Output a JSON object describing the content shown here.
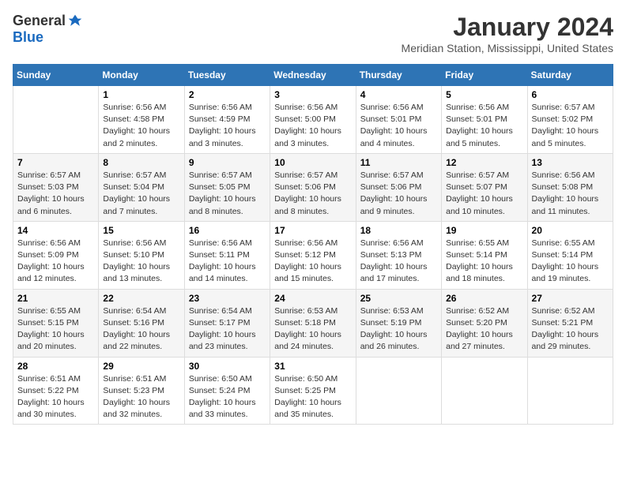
{
  "logo": {
    "general": "General",
    "blue": "Blue"
  },
  "title": "January 2024",
  "subtitle": "Meridian Station, Mississippi, United States",
  "calendar": {
    "headers": [
      "Sunday",
      "Monday",
      "Tuesday",
      "Wednesday",
      "Thursday",
      "Friday",
      "Saturday"
    ],
    "weeks": [
      [
        {
          "day": "",
          "info": ""
        },
        {
          "day": "1",
          "info": "Sunrise: 6:56 AM\nSunset: 4:58 PM\nDaylight: 10 hours\nand 2 minutes."
        },
        {
          "day": "2",
          "info": "Sunrise: 6:56 AM\nSunset: 4:59 PM\nDaylight: 10 hours\nand 3 minutes."
        },
        {
          "day": "3",
          "info": "Sunrise: 6:56 AM\nSunset: 5:00 PM\nDaylight: 10 hours\nand 3 minutes."
        },
        {
          "day": "4",
          "info": "Sunrise: 6:56 AM\nSunset: 5:01 PM\nDaylight: 10 hours\nand 4 minutes."
        },
        {
          "day": "5",
          "info": "Sunrise: 6:56 AM\nSunset: 5:01 PM\nDaylight: 10 hours\nand 5 minutes."
        },
        {
          "day": "6",
          "info": "Sunrise: 6:57 AM\nSunset: 5:02 PM\nDaylight: 10 hours\nand 5 minutes."
        }
      ],
      [
        {
          "day": "7",
          "info": "Sunrise: 6:57 AM\nSunset: 5:03 PM\nDaylight: 10 hours\nand 6 minutes."
        },
        {
          "day": "8",
          "info": "Sunrise: 6:57 AM\nSunset: 5:04 PM\nDaylight: 10 hours\nand 7 minutes."
        },
        {
          "day": "9",
          "info": "Sunrise: 6:57 AM\nSunset: 5:05 PM\nDaylight: 10 hours\nand 8 minutes."
        },
        {
          "day": "10",
          "info": "Sunrise: 6:57 AM\nSunset: 5:06 PM\nDaylight: 10 hours\nand 8 minutes."
        },
        {
          "day": "11",
          "info": "Sunrise: 6:57 AM\nSunset: 5:06 PM\nDaylight: 10 hours\nand 9 minutes."
        },
        {
          "day": "12",
          "info": "Sunrise: 6:57 AM\nSunset: 5:07 PM\nDaylight: 10 hours\nand 10 minutes."
        },
        {
          "day": "13",
          "info": "Sunrise: 6:56 AM\nSunset: 5:08 PM\nDaylight: 10 hours\nand 11 minutes."
        }
      ],
      [
        {
          "day": "14",
          "info": "Sunrise: 6:56 AM\nSunset: 5:09 PM\nDaylight: 10 hours\nand 12 minutes."
        },
        {
          "day": "15",
          "info": "Sunrise: 6:56 AM\nSunset: 5:10 PM\nDaylight: 10 hours\nand 13 minutes."
        },
        {
          "day": "16",
          "info": "Sunrise: 6:56 AM\nSunset: 5:11 PM\nDaylight: 10 hours\nand 14 minutes."
        },
        {
          "day": "17",
          "info": "Sunrise: 6:56 AM\nSunset: 5:12 PM\nDaylight: 10 hours\nand 15 minutes."
        },
        {
          "day": "18",
          "info": "Sunrise: 6:56 AM\nSunset: 5:13 PM\nDaylight: 10 hours\nand 17 minutes."
        },
        {
          "day": "19",
          "info": "Sunrise: 6:55 AM\nSunset: 5:14 PM\nDaylight: 10 hours\nand 18 minutes."
        },
        {
          "day": "20",
          "info": "Sunrise: 6:55 AM\nSunset: 5:14 PM\nDaylight: 10 hours\nand 19 minutes."
        }
      ],
      [
        {
          "day": "21",
          "info": "Sunrise: 6:55 AM\nSunset: 5:15 PM\nDaylight: 10 hours\nand 20 minutes."
        },
        {
          "day": "22",
          "info": "Sunrise: 6:54 AM\nSunset: 5:16 PM\nDaylight: 10 hours\nand 22 minutes."
        },
        {
          "day": "23",
          "info": "Sunrise: 6:54 AM\nSunset: 5:17 PM\nDaylight: 10 hours\nand 23 minutes."
        },
        {
          "day": "24",
          "info": "Sunrise: 6:53 AM\nSunset: 5:18 PM\nDaylight: 10 hours\nand 24 minutes."
        },
        {
          "day": "25",
          "info": "Sunrise: 6:53 AM\nSunset: 5:19 PM\nDaylight: 10 hours\nand 26 minutes."
        },
        {
          "day": "26",
          "info": "Sunrise: 6:52 AM\nSunset: 5:20 PM\nDaylight: 10 hours\nand 27 minutes."
        },
        {
          "day": "27",
          "info": "Sunrise: 6:52 AM\nSunset: 5:21 PM\nDaylight: 10 hours\nand 29 minutes."
        }
      ],
      [
        {
          "day": "28",
          "info": "Sunrise: 6:51 AM\nSunset: 5:22 PM\nDaylight: 10 hours\nand 30 minutes."
        },
        {
          "day": "29",
          "info": "Sunrise: 6:51 AM\nSunset: 5:23 PM\nDaylight: 10 hours\nand 32 minutes."
        },
        {
          "day": "30",
          "info": "Sunrise: 6:50 AM\nSunset: 5:24 PM\nDaylight: 10 hours\nand 33 minutes."
        },
        {
          "day": "31",
          "info": "Sunrise: 6:50 AM\nSunset: 5:25 PM\nDaylight: 10 hours\nand 35 minutes."
        },
        {
          "day": "",
          "info": ""
        },
        {
          "day": "",
          "info": ""
        },
        {
          "day": "",
          "info": ""
        }
      ]
    ]
  }
}
